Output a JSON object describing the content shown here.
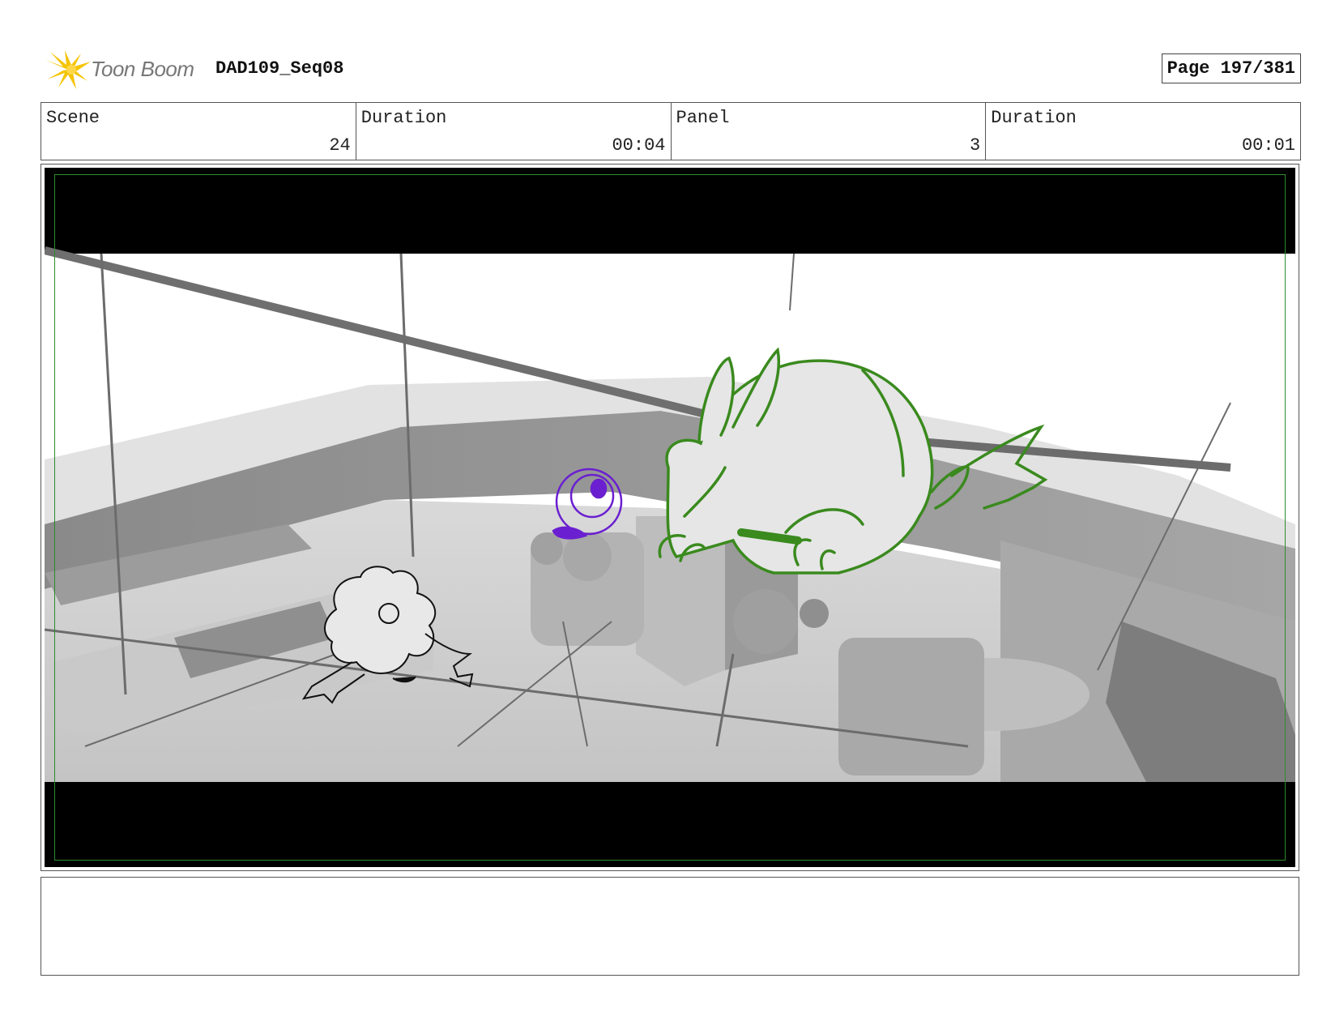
{
  "header": {
    "logo_text": "Toon Boom",
    "project_title": "DAD109_Seq08",
    "page_label": "Page 197/381"
  },
  "info": {
    "scene_label": "Scene",
    "scene_value": "24",
    "scene_duration_label": "Duration",
    "scene_duration_value": "00:04",
    "panel_label": "Panel",
    "panel_value": "3",
    "panel_duration_label": "Duration",
    "panel_duration_value": "00:01"
  },
  "colors": {
    "logo_yellow": "#f5c400",
    "safe_frame_green": "#2e8b2e",
    "rabbit_green": "#3a8a1e",
    "creature_purple": "#6a1fd0"
  },
  "notes": {
    "text": ""
  }
}
